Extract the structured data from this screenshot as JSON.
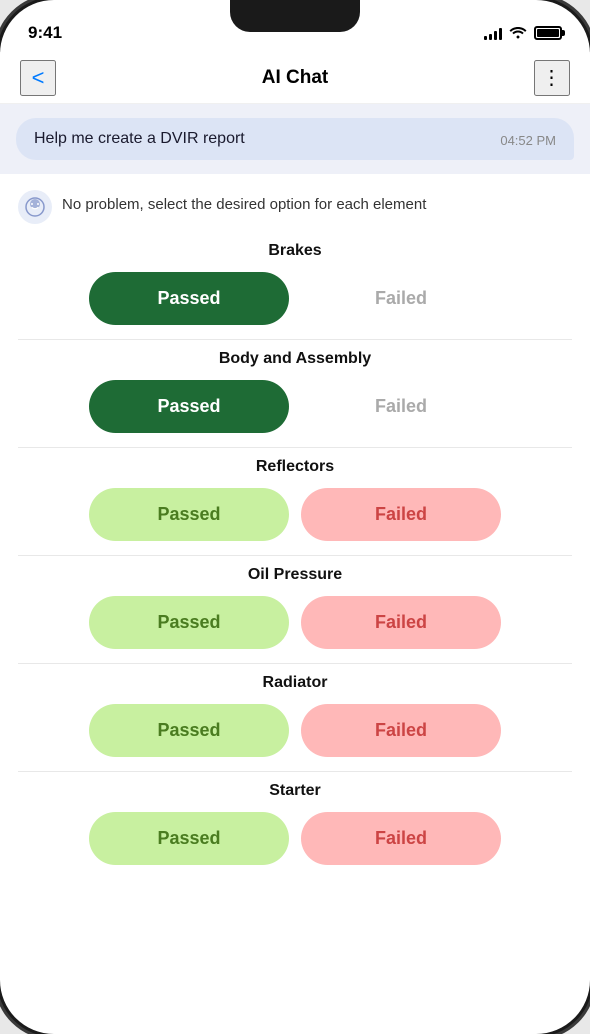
{
  "statusBar": {
    "time": "9:41",
    "icons": {
      "signal": "signal-icon",
      "wifi": "wifi-icon",
      "battery": "battery-icon"
    }
  },
  "navBar": {
    "backLabel": "<",
    "title": "AI Chat",
    "moreLabel": "⋮"
  },
  "userMessage": {
    "text": "Help me create a DVIR report",
    "time": "04:52 PM"
  },
  "aiMessage": {
    "text": "No problem, select the desired option for each element"
  },
  "sections": [
    {
      "title": "Brakes",
      "passedStyle": "dark",
      "passedLabel": "Passed",
      "failedLabel": "Failed",
      "failedStyle": "muted"
    },
    {
      "title": "Body and Assembly",
      "passedStyle": "dark",
      "passedLabel": "Passed",
      "failedLabel": "Failed",
      "failedStyle": "muted"
    },
    {
      "title": "Reflectors",
      "passedStyle": "light",
      "passedLabel": "Passed",
      "failedLabel": "Failed",
      "failedStyle": "light"
    },
    {
      "title": "Oil Pressure",
      "passedStyle": "light",
      "passedLabel": "Passed",
      "failedLabel": "Failed",
      "failedStyle": "light"
    },
    {
      "title": "Radiator",
      "passedStyle": "light",
      "passedLabel": "Passed",
      "failedLabel": "Failed",
      "failedStyle": "light"
    },
    {
      "title": "Starter",
      "passedStyle": "light",
      "passedLabel": "Passed",
      "failedLabel": "Failed",
      "failedStyle": "light"
    }
  ]
}
